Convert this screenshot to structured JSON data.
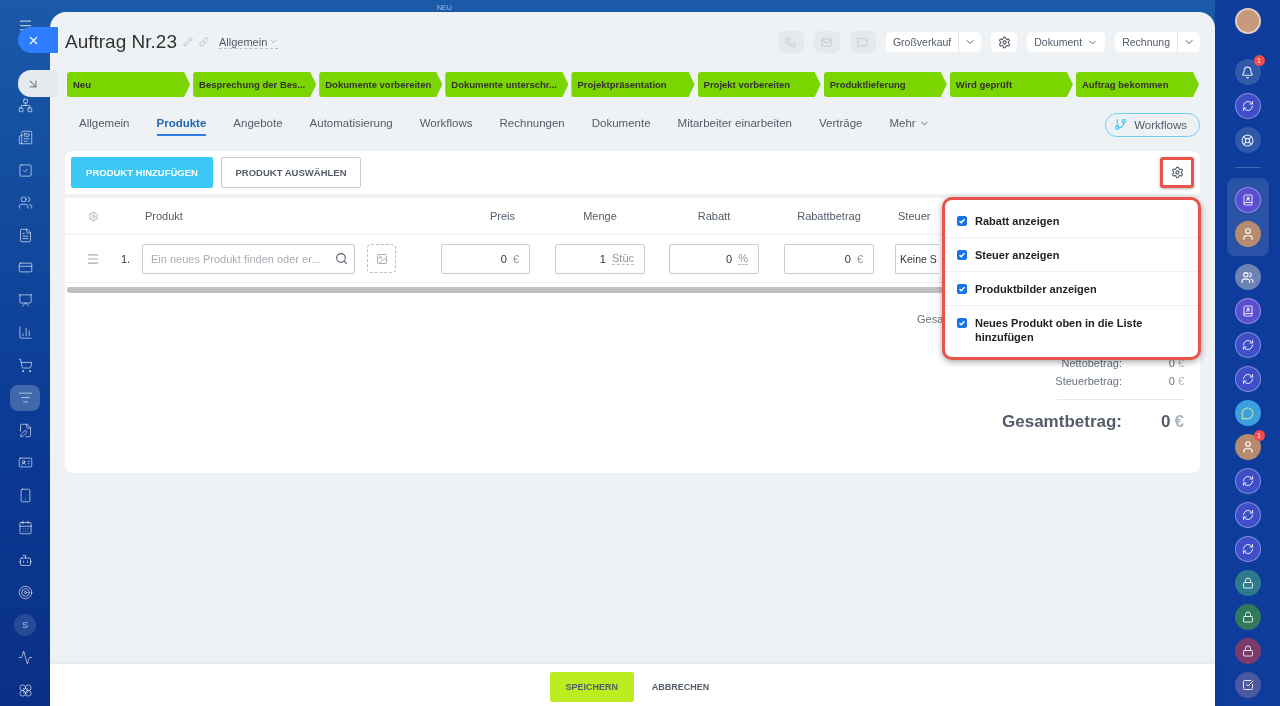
{
  "top_bar": {
    "label": "NEU"
  },
  "left_sidebar": {
    "items": [
      {
        "kind": "network",
        "selected": false
      },
      {
        "kind": "news",
        "selected": false
      },
      {
        "kind": "task",
        "selected": false
      },
      {
        "kind": "users",
        "selected": false
      },
      {
        "kind": "document",
        "selected": false
      },
      {
        "kind": "card",
        "selected": false
      },
      {
        "kind": "presentation",
        "selected": false
      },
      {
        "kind": "chart",
        "selected": false
      },
      {
        "kind": "cart",
        "selected": false
      },
      {
        "kind": "filter",
        "selected": true
      },
      {
        "kind": "edit",
        "selected": false
      },
      {
        "kind": "contact",
        "selected": false
      },
      {
        "kind": "phone",
        "selected": false
      },
      {
        "kind": "calendar",
        "selected": false
      },
      {
        "kind": "bot",
        "selected": false
      },
      {
        "kind": "target",
        "selected": false
      },
      {
        "kind": "letter",
        "label": "S",
        "selected": false
      },
      {
        "kind": "waves",
        "selected": false
      },
      {
        "kind": "flower",
        "selected": false
      }
    ]
  },
  "window": {
    "title": "Auftrag Nr.23",
    "category": "Allgemein"
  },
  "header_actions": [
    {
      "kind": "phone"
    },
    {
      "kind": "mail"
    },
    {
      "kind": "chat"
    },
    {
      "kind": "split",
      "label": "Großverkauf"
    },
    {
      "kind": "settings"
    },
    {
      "kind": "dropdown",
      "label": "Dokument"
    },
    {
      "kind": "split",
      "label": "Rechnung"
    }
  ],
  "stages": [
    {
      "label": "Neu"
    },
    {
      "label": "Besprechung der Bes..."
    },
    {
      "label": "Dokumente vorbereiten"
    },
    {
      "label": "Dokumente unterschr..."
    },
    {
      "label": "Projektpräsentation"
    },
    {
      "label": "Projekt vorbereiten"
    },
    {
      "label": "Produktlieferung"
    },
    {
      "label": "Wird geprüft"
    },
    {
      "label": "Auftrag bekommen"
    }
  ],
  "tabs": [
    {
      "label": "Allgemein",
      "selected": false
    },
    {
      "label": "Produkte",
      "selected": true
    },
    {
      "label": "Angebote",
      "selected": false
    },
    {
      "label": "Automatisierung",
      "selected": false
    },
    {
      "label": "Workflows",
      "selected": false
    },
    {
      "label": "Rechnungen",
      "selected": false
    },
    {
      "label": "Dokumente",
      "selected": false
    },
    {
      "label": "Mitarbeiter einarbeiten",
      "selected": false
    },
    {
      "label": "Verträge",
      "selected": false
    },
    {
      "label": "Mehr",
      "selected": false
    }
  ],
  "workflows_button": "Workflows",
  "toolbar": {
    "add_button": "PRODUKT HINZUFÜGEN",
    "select_button": "PRODUKT AUSWÄHLEN"
  },
  "table": {
    "columns": [
      "Produkt",
      "Preis",
      "Menge",
      "Rabatt",
      "Rabattbetrag",
      "Steuer"
    ],
    "rows": [
      {
        "number": "1.",
        "product_placeholder": "Ein neues Produkt finden oder er...",
        "price": "0",
        "price_unit": "€",
        "quantity": "1",
        "quantity_unit": "Stüc",
        "discount": "0",
        "discount_unit": "%",
        "discount_amount": "0",
        "discount_amount_unit": "€",
        "tax": "Keine S"
      }
    ]
  },
  "settings_menu": {
    "items": [
      {
        "label": "Rabatt anzeigen",
        "checked": true
      },
      {
        "label": "Steuer anzeigen",
        "checked": true
      },
      {
        "label": "Produktbilder anzeigen",
        "checked": true
      },
      {
        "label": "Neues Produkt oben in die Liste hinzufügen",
        "checked": true
      }
    ]
  },
  "summary": {
    "rows": [
      {
        "label": "Gesa"
      },
      {
        "label": "Nettobetrag:",
        "value": "0",
        "unit": "€"
      },
      {
        "label": "Steuerbetrag:",
        "value": "0",
        "unit": "€"
      }
    ],
    "total": {
      "label": "Gesamtbetrag:",
      "value": "0",
      "unit": "€"
    }
  },
  "footer": {
    "save": "SPEICHERN",
    "cancel": "ABBRECHEN"
  },
  "right_sidebar": {
    "tools": [
      {
        "kind": "bell",
        "badge": "1"
      },
      {
        "kind": "swirl"
      },
      {
        "kind": "support"
      }
    ],
    "pinned": [
      {
        "kind": "app"
      },
      {
        "kind": "face"
      }
    ],
    "chats": [
      {
        "kind": "people"
      },
      {
        "kind": "app"
      },
      {
        "kind": "swirl"
      },
      {
        "kind": "swirl"
      },
      {
        "kind": "chat"
      },
      {
        "kind": "face",
        "badge": "1"
      },
      {
        "kind": "swirl"
      },
      {
        "kind": "swirl"
      },
      {
        "kind": "swirl"
      },
      {
        "kind": "lock",
        "color": "#2e7a8c"
      },
      {
        "kind": "lock",
        "color": "#2f7a5a"
      },
      {
        "kind": "lock",
        "color": "#7a3a6a"
      },
      {
        "kind": "task"
      }
    ]
  }
}
